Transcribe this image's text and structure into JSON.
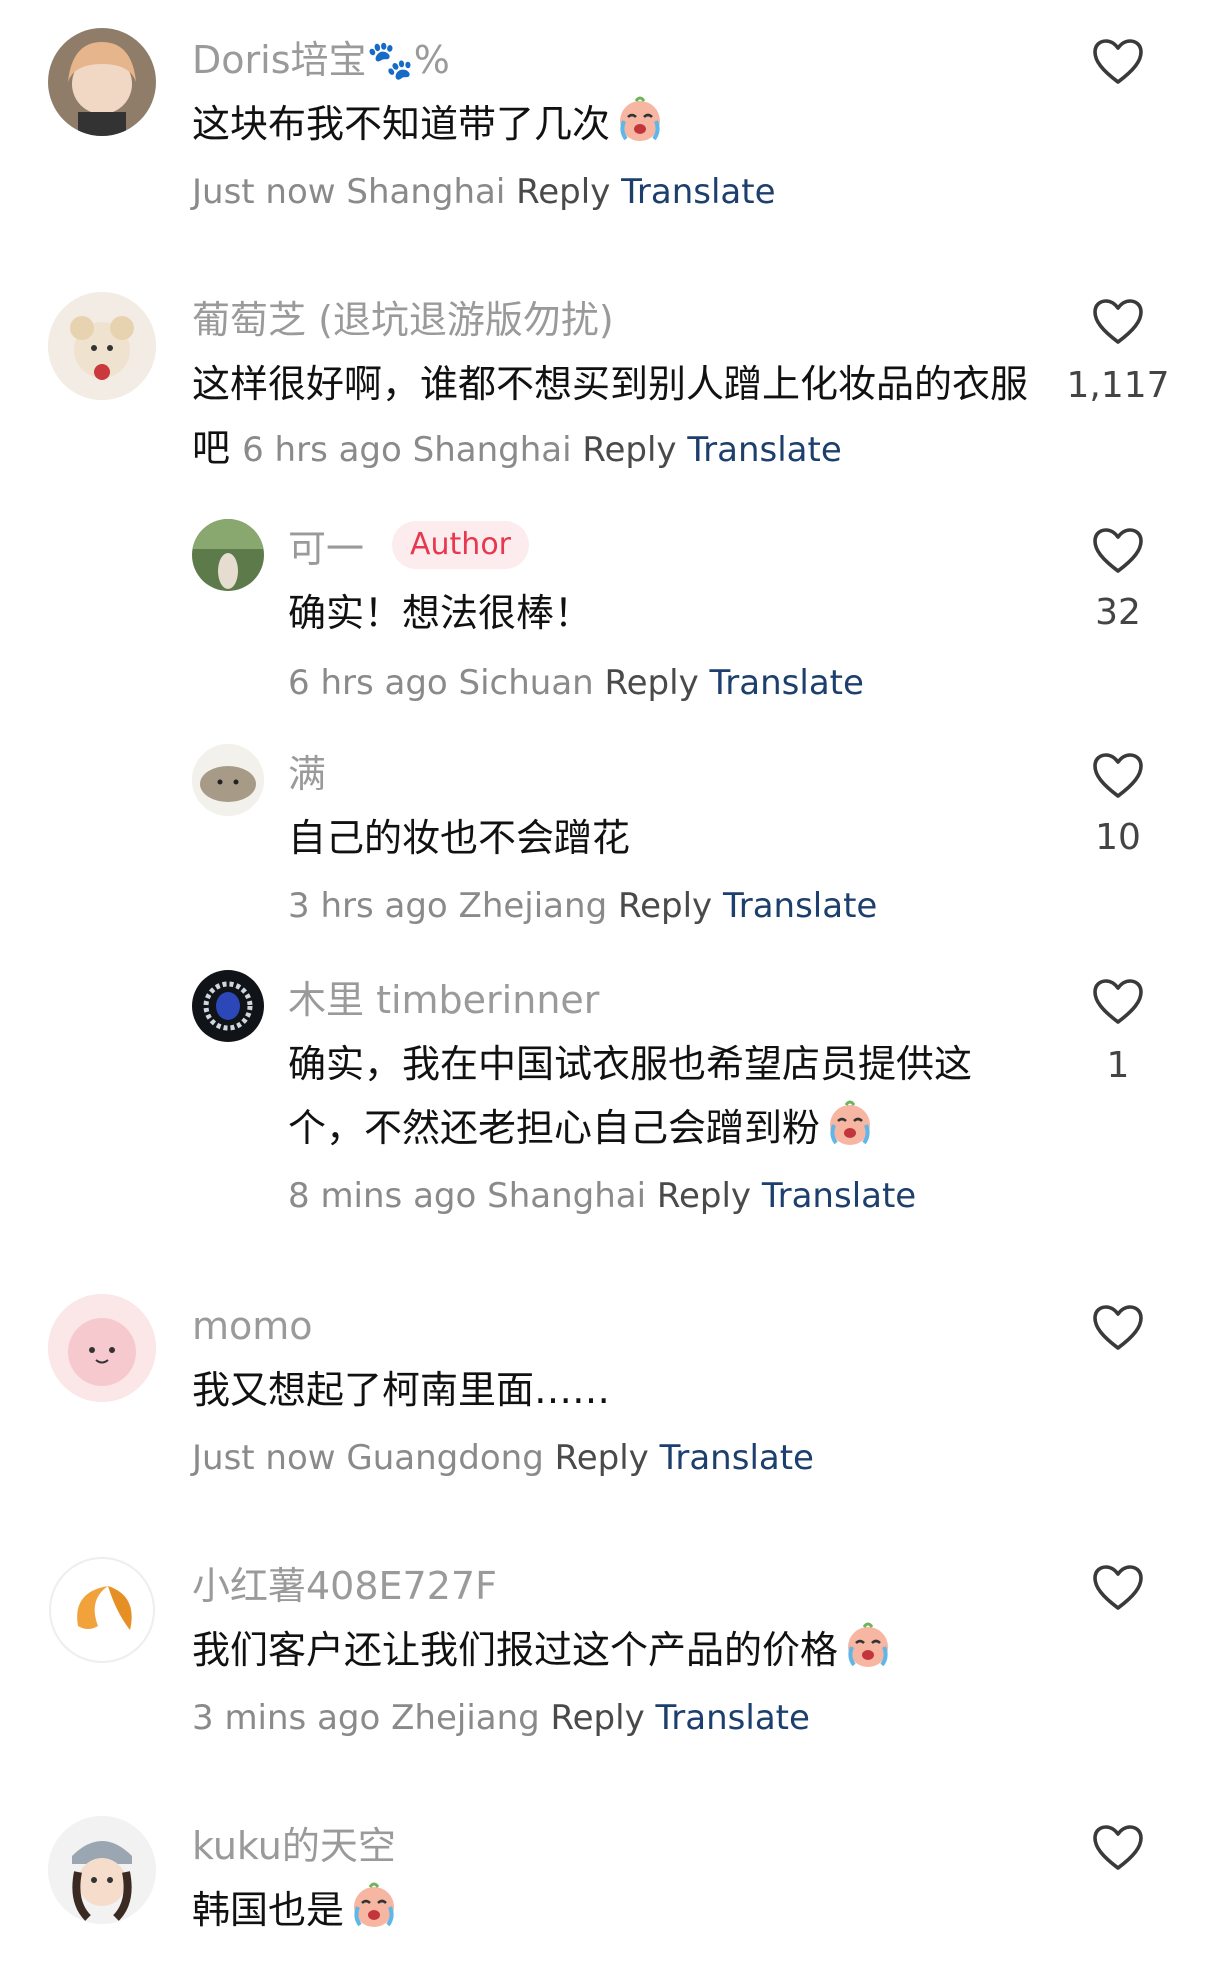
{
  "comments": [
    {
      "username": "Doris培宝🐾%",
      "text": "这块布我不知道带了几次",
      "time": "Just now",
      "location": "Shanghai",
      "reply_label": "Reply",
      "translate_label": "Translate",
      "likes": ""
    },
    {
      "username": "葡萄芝 (退坑退游版勿扰)",
      "text": "这样很好啊，谁都不想买到别人蹭上化妆品的衣服吧",
      "time": "6 hrs ago",
      "location": "Shanghai",
      "reply_label": "Reply",
      "translate_label": "Translate",
      "likes": "1,117",
      "replies": [
        {
          "username": "可一",
          "badge": "Author",
          "text": "确实！想法很棒！",
          "time": "6 hrs ago",
          "location": "Sichuan",
          "reply_label": "Reply",
          "translate_label": "Translate",
          "likes": "32"
        },
        {
          "username": "满",
          "text": "自己的妆也不会蹭花",
          "time": "3 hrs ago",
          "location": "Zhejiang",
          "reply_label": "Reply",
          "translate_label": "Translate",
          "likes": "10"
        },
        {
          "username": "木里 timberinner",
          "text_line1": "确实，我在中国试衣服也希望店员提供这",
          "text_line2": "个，不然还老担心自己会蹭到粉",
          "time": "8 mins ago",
          "location": "Shanghai",
          "reply_label": "Reply",
          "translate_label": "Translate",
          "likes": "1"
        }
      ]
    },
    {
      "username": "momo",
      "text": "我又想起了柯南里面……",
      "time": "Just now",
      "location": "Guangdong",
      "reply_label": "Reply",
      "translate_label": "Translate",
      "likes": ""
    },
    {
      "username": "小红薯408E727F",
      "text": "我们客户还让我们报过这个产品的价格",
      "time": "3 mins ago",
      "location": "Zhejiang",
      "reply_label": "Reply",
      "translate_label": "Translate",
      "likes": ""
    },
    {
      "username": "kuku的天空",
      "text": "韩国也是",
      "likes": ""
    }
  ],
  "icons": {
    "like": "heart-outline-icon",
    "emoji": "crying-face-emoji"
  },
  "colors": {
    "author_badge_text": "#e8384f",
    "author_badge_bg": "#fdecee",
    "translate_link": "#1d3f6e"
  }
}
